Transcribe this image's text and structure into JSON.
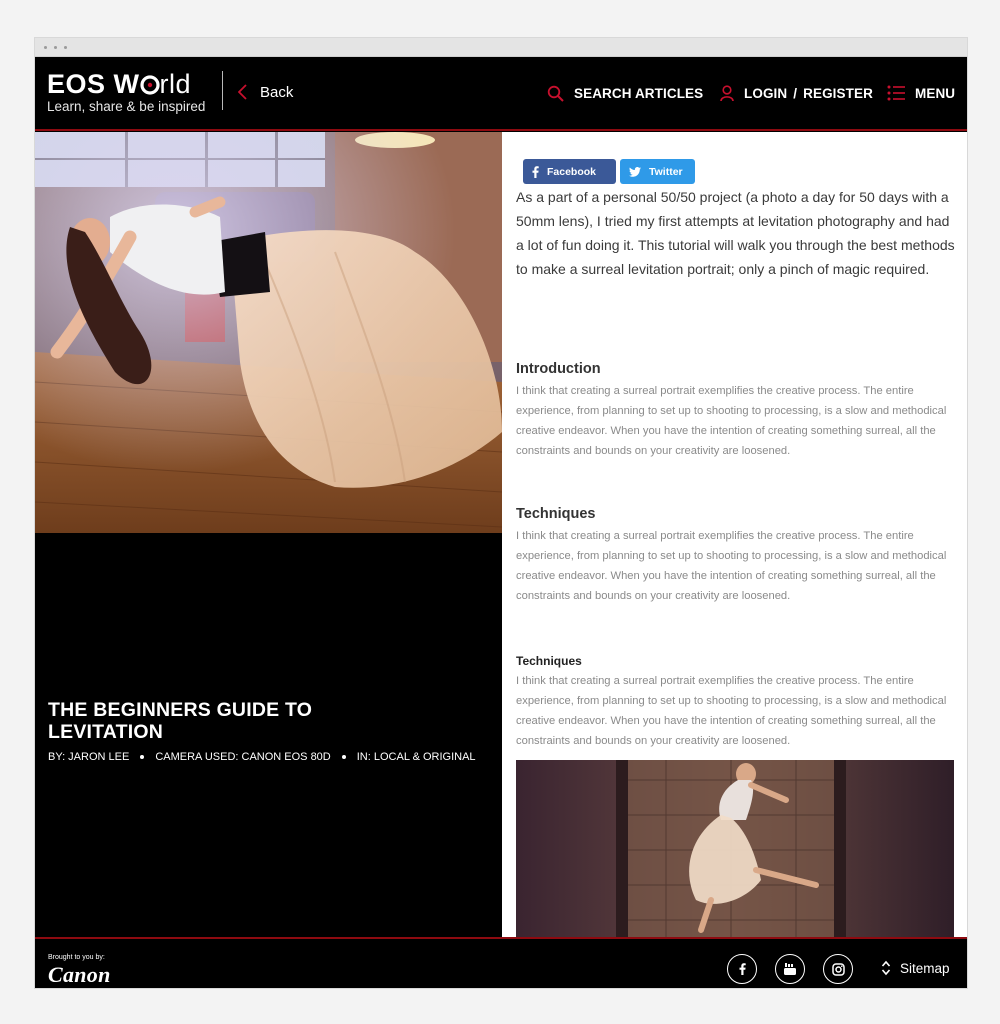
{
  "header": {
    "logo_title_bold": "EOS W",
    "logo_title_light": "rld",
    "logo_tagline": "Learn, share & be inspired",
    "back_label": "Back",
    "search_label": "SEARCH ARTICLES",
    "login_label": "LOGIN",
    "login_separator": "/",
    "register_label": "REGISTER",
    "menu_label": "MENU"
  },
  "article": {
    "title": "THE BEGINNERS GUIDE TO LEVITATION",
    "author": "BY: JARON LEE",
    "camera": "CAMERA USED: CANON EOS 80D",
    "category": "IN: LOCAL & ORIGINAL",
    "intro": "As a part of a personal 50/50 project (a photo a day for 50 days with a 50mm lens), I tried my first attempts at levitation photography and had a lot of fun doing it. This tutorial will walk you through the best methods to make a surreal levitation portrait; only a pinch of magic required.",
    "sections": [
      {
        "heading": "Introduction",
        "body": "I think that creating a surreal portrait exemplifies the creative process. The entire experience, from planning to set up to shooting to processing, is a slow and methodical creative endeavor. When you have the intention of creating something surreal, all the constraints and bounds on your creativity are loosened."
      },
      {
        "heading": "Techniques",
        "body": "I think that creating a surreal portrait exemplifies the creative process. The entire experience, from planning to set up to shooting to processing, is a slow and methodical creative endeavor. When you have the intention of creating something surreal, all the constraints and bounds on your creativity are loosened."
      },
      {
        "heading": "Techniques",
        "body": "I think that creating a surreal portrait exemplifies the creative process. The entire experience, from planning to set up to shooting to processing, is a slow and methodical creative endeavor. When you have the intention of creating something surreal, all the constraints and bounds on your creativity are loosened."
      }
    ]
  },
  "share": {
    "facebook_label": "Facebook",
    "twitter_label": "Twitter"
  },
  "footer": {
    "brought_by": "Brought to you by:",
    "brand": "Canon",
    "sitemap_label": "Sitemap"
  },
  "icons": {
    "search": "search-icon",
    "user": "user-icon",
    "menu": "menu-list-icon",
    "back": "chevron-left-icon",
    "facebook": "facebook-icon",
    "twitter": "twitter-icon",
    "youtube": "youtube-icon",
    "instagram": "instagram-icon",
    "sitemap": "chevron-up-down-icon"
  },
  "colors": {
    "accent_red": "#c8102e",
    "header_border": "#8e0a10",
    "facebook_blue": "#3b5998",
    "twitter_blue": "#2f9ae8"
  }
}
